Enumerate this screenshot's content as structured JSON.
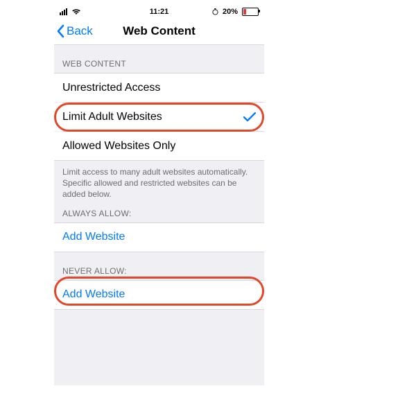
{
  "status": {
    "time": "11:21",
    "battery_text": "20%"
  },
  "nav": {
    "back_label": "Back",
    "title": "Web Content"
  },
  "sections": {
    "web_content": {
      "header": "WEB CONTENT",
      "options": {
        "unrestricted": "Unrestricted Access",
        "limit_adult": "Limit Adult Websites",
        "allowed_only": "Allowed Websites Only"
      },
      "footer": "Limit access to many adult websites automatically. Specific allowed and restricted websites can be added below."
    },
    "always_allow": {
      "header": "ALWAYS ALLOW:",
      "add_label": "Add Website"
    },
    "never_allow": {
      "header": "NEVER ALLOW:",
      "add_label": "Add Website"
    }
  }
}
